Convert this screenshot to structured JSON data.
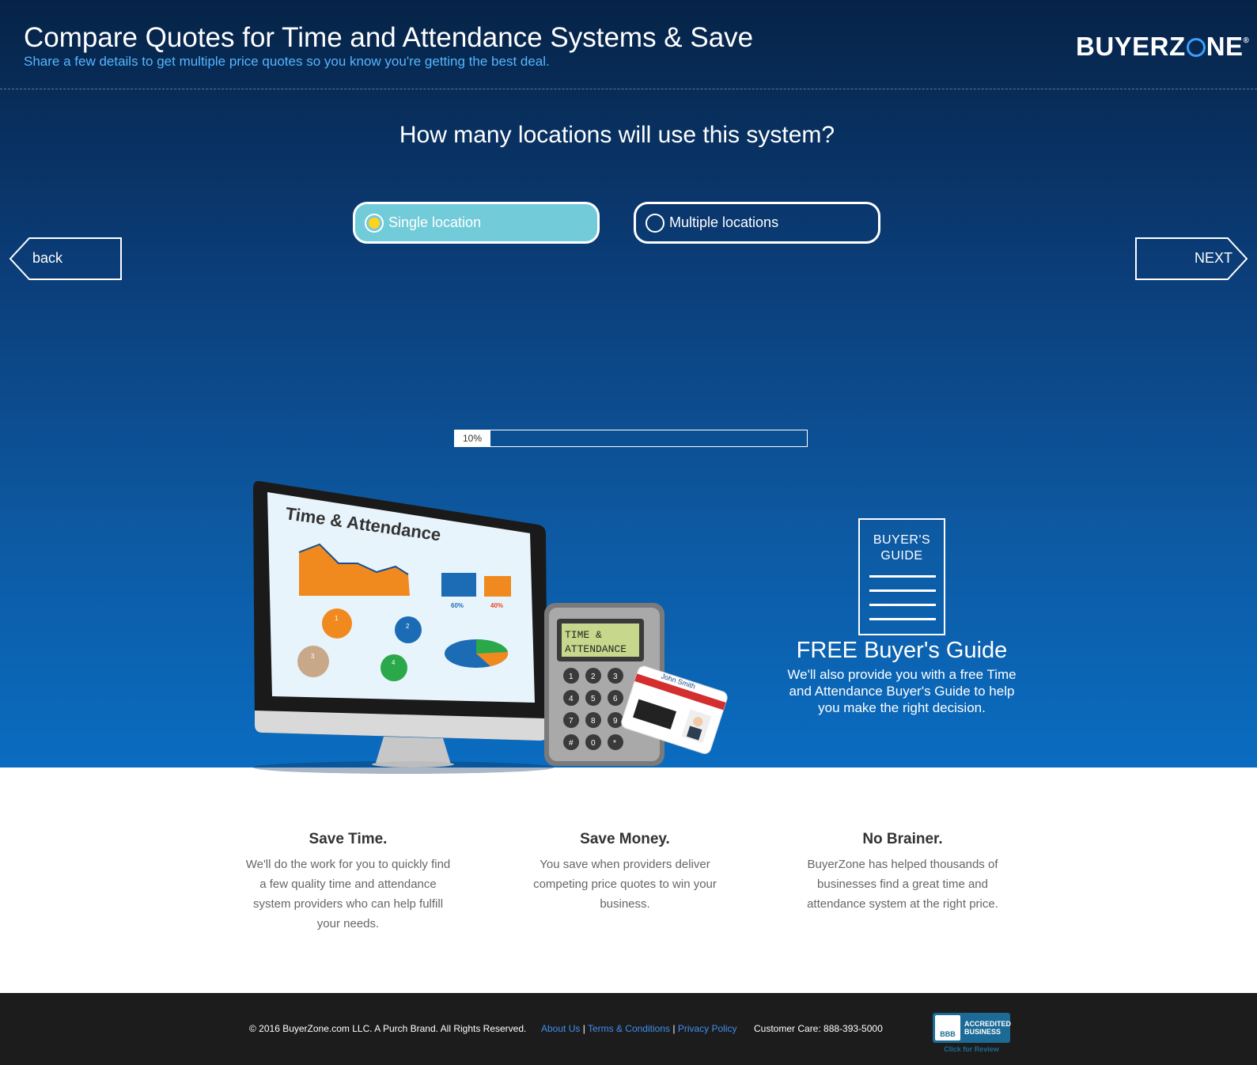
{
  "header": {
    "title": "Compare Quotes for Time and Attendance Systems & Save",
    "subtitle": "Share a few details to get multiple price quotes so you know you're getting the best deal.",
    "logo_left": "BUYERZ",
    "logo_right": "NE",
    "logo_mark": "®"
  },
  "question": "How many locations will use this system?",
  "options": [
    {
      "label": "Single location",
      "selected": true
    },
    {
      "label": "Multiple locations",
      "selected": false
    }
  ],
  "nav": {
    "back_label": "back",
    "next_label": "NEXT"
  },
  "progress": {
    "label": "10%",
    "value": 0.1
  },
  "illustration": {
    "screen_title": "Time & Attendance",
    "keypad_display_line1": "TIME &",
    "keypad_display_line2": "ATTENDANCE",
    "card_name": "John Smith",
    "stat_a": "60%",
    "stat_b": "40%",
    "keys": [
      "1",
      "2",
      "3",
      "4",
      "5",
      "6",
      "7",
      "8",
      "9",
      "#",
      "0",
      "*"
    ],
    "flow_steps": [
      "1",
      "2",
      "3",
      "4"
    ]
  },
  "buyers_guide": {
    "icon_line1": "BUYER'S",
    "icon_line2": "GUIDE",
    "title": "FREE Buyer's Guide",
    "text": "We'll also provide you with a free Time and Attendance Buyer's Guide to help you make the right decision."
  },
  "benefits": [
    {
      "title": "Save Time.",
      "text": "We'll do the work for you to quickly find a few quality time and attendance system providers who can help fulfill your needs."
    },
    {
      "title": "Save Money.",
      "text": "You save when providers deliver competing price quotes to win your business."
    },
    {
      "title": "No Brainer.",
      "text": "BuyerZone has helped thousands of businesses find a great time and attendance system at the right price."
    }
  ],
  "footer": {
    "copyright": "© 2016 BuyerZone.com LLC. A Purch Brand. All Rights Reserved.",
    "links": [
      "About Us",
      "Terms & Conditions",
      "Privacy Policy"
    ],
    "separator": "|",
    "customer_care": "Customer Care: 888-393-5000",
    "bbb_seal": "BBB",
    "bbb_line1": "ACCREDITED",
    "bbb_line2": "BUSINESS",
    "bbb_review": "Click for Review"
  },
  "colors": {
    "accent": "#55b6ff",
    "selected_option": "#72cbd9",
    "radio_dot": "#ffd21c",
    "footer_bg": "#1c1c1c",
    "link": "#3f8ef0"
  }
}
